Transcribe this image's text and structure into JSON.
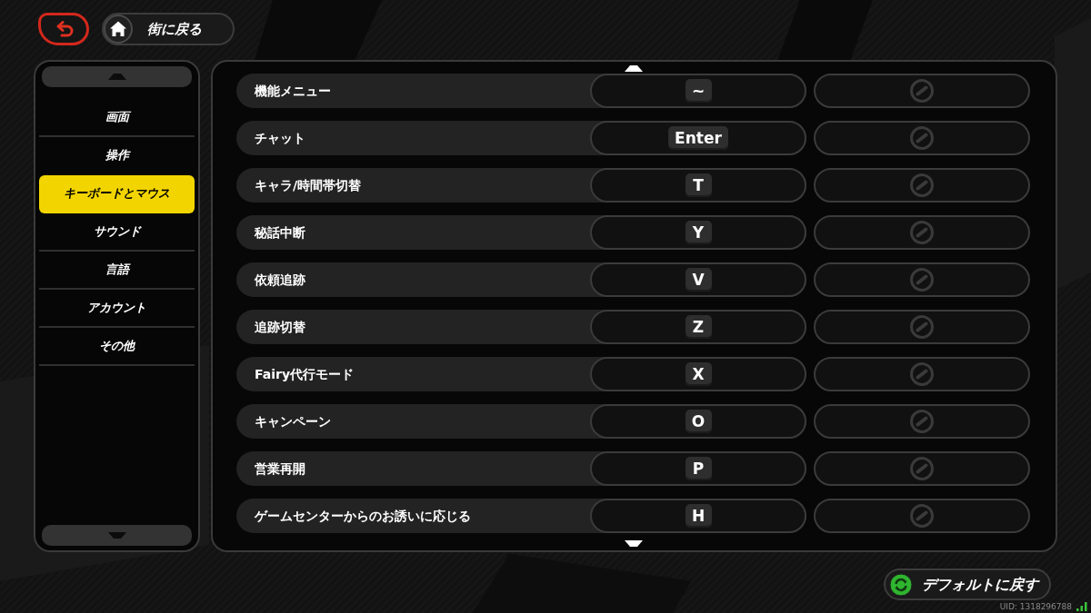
{
  "town_button": {
    "label": "街に戻る"
  },
  "sidebar": {
    "items": [
      {
        "label": "画面",
        "selected": false
      },
      {
        "label": "操作",
        "selected": false
      },
      {
        "label": "キーボードとマウス",
        "selected": true
      },
      {
        "label": "サウンド",
        "selected": false
      },
      {
        "label": "言語",
        "selected": false
      },
      {
        "label": "アカウント",
        "selected": false
      },
      {
        "label": "その他",
        "selected": false
      }
    ]
  },
  "bindings": {
    "rows": [
      {
        "action": "機能メニュー",
        "keys": [
          "~"
        ]
      },
      {
        "action": "チャット",
        "keys": [
          "Enter"
        ]
      },
      {
        "action": "キャラ/時間帯切替",
        "keys": [
          "T"
        ]
      },
      {
        "action": "秘話中断",
        "keys": [
          "Y"
        ]
      },
      {
        "action": "依頼追跡",
        "keys": [
          "V"
        ]
      },
      {
        "action": "追跡切替",
        "keys": [
          "Z"
        ]
      },
      {
        "action": "Fairy代行モード",
        "keys": [
          "X"
        ]
      },
      {
        "action": "キャンペーン",
        "keys": [
          "O"
        ]
      },
      {
        "action": "営業再開",
        "keys": [
          "P"
        ]
      },
      {
        "action": "ゲームセンターからのお誘いに応じる",
        "keys": [
          "H"
        ]
      }
    ]
  },
  "reset_button": {
    "label": "デフォルトに戻す"
  },
  "uid": "UID: 1318296788"
}
